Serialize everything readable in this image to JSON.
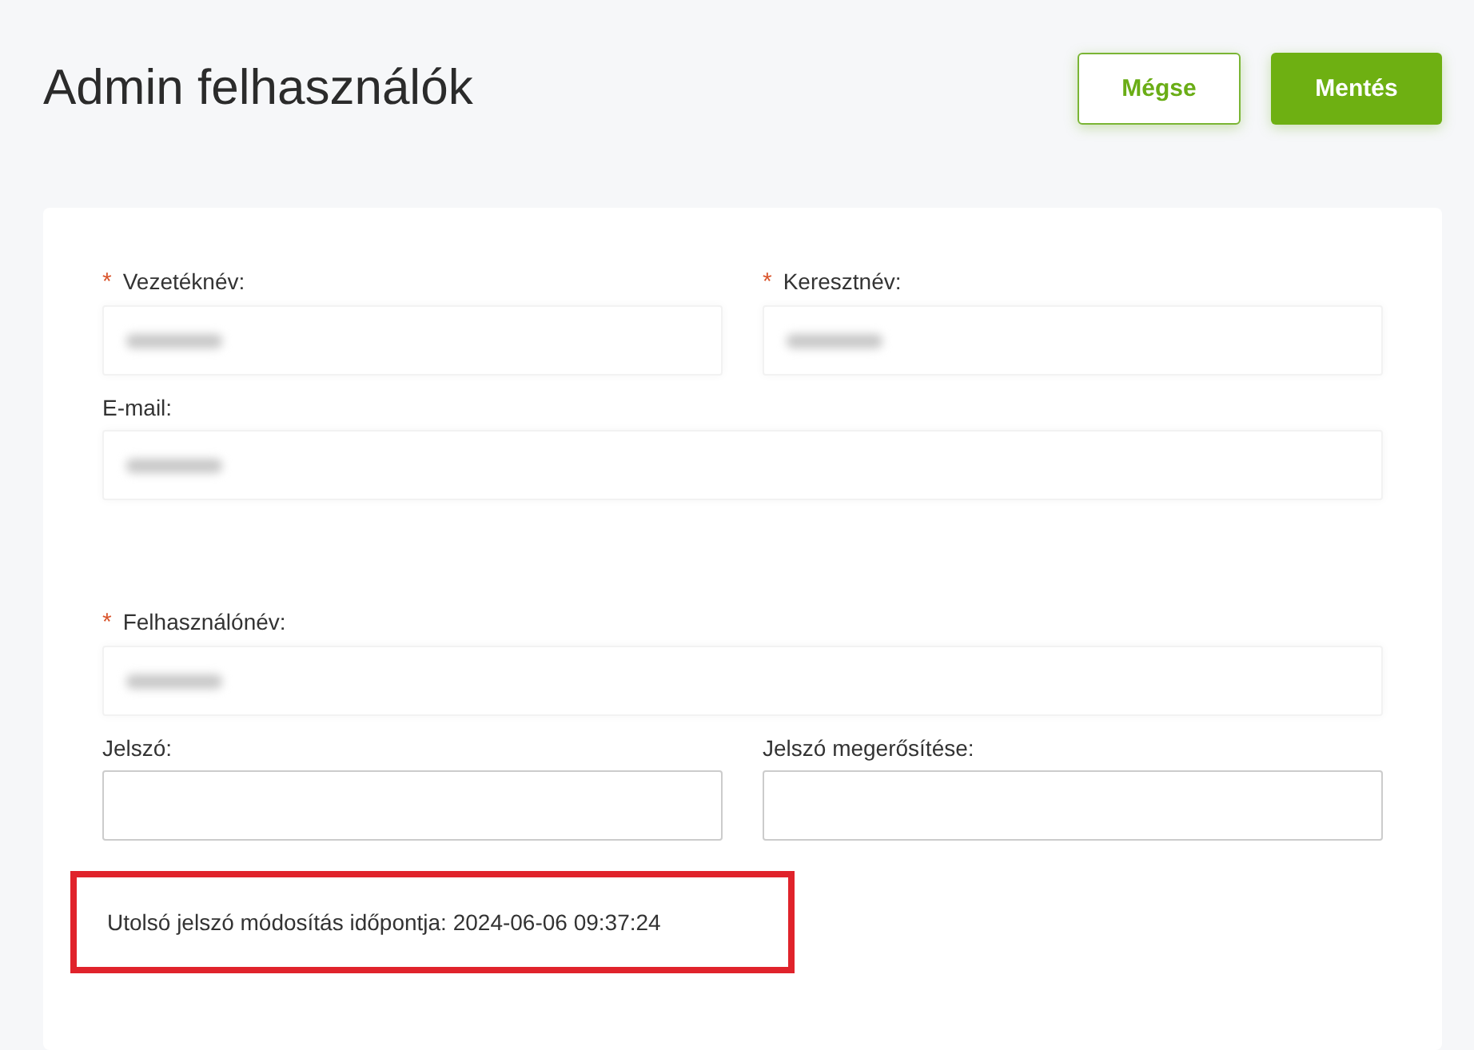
{
  "page_title": "Admin felhasználók",
  "buttons": [
    {
      "label": "Mégse",
      "kind": "secondary"
    },
    {
      "label": "Mentés",
      "kind": "primary"
    }
  ],
  "rows": [
    {
      "fields": [
        {
          "label": "Vezetéknév:",
          "required": true,
          "value_blurred": true,
          "required_mark": "*"
        },
        {
          "label": "Keresztnév:",
          "required": true,
          "value_blurred": true,
          "required_mark": "*"
        }
      ]
    },
    {
      "fields": [
        {
          "label": "E-mail:",
          "required": false,
          "value_blurred": true
        }
      ]
    },
    {
      "fields": [
        {
          "label": "Felhasználónév:",
          "required": true,
          "value_blurred": true,
          "required_mark": "*"
        }
      ]
    },
    {
      "fields": [
        {
          "label": "Jelszó:",
          "required": false,
          "value_blurred": false
        },
        {
          "label": "Jelszó megerősítése:",
          "required": false,
          "value_blurred": false
        }
      ]
    }
  ],
  "password_note": {
    "text": "Utolsó jelszó módosítás időpontja: 2024-06-06 09:37:24",
    "highlighted": true
  }
}
